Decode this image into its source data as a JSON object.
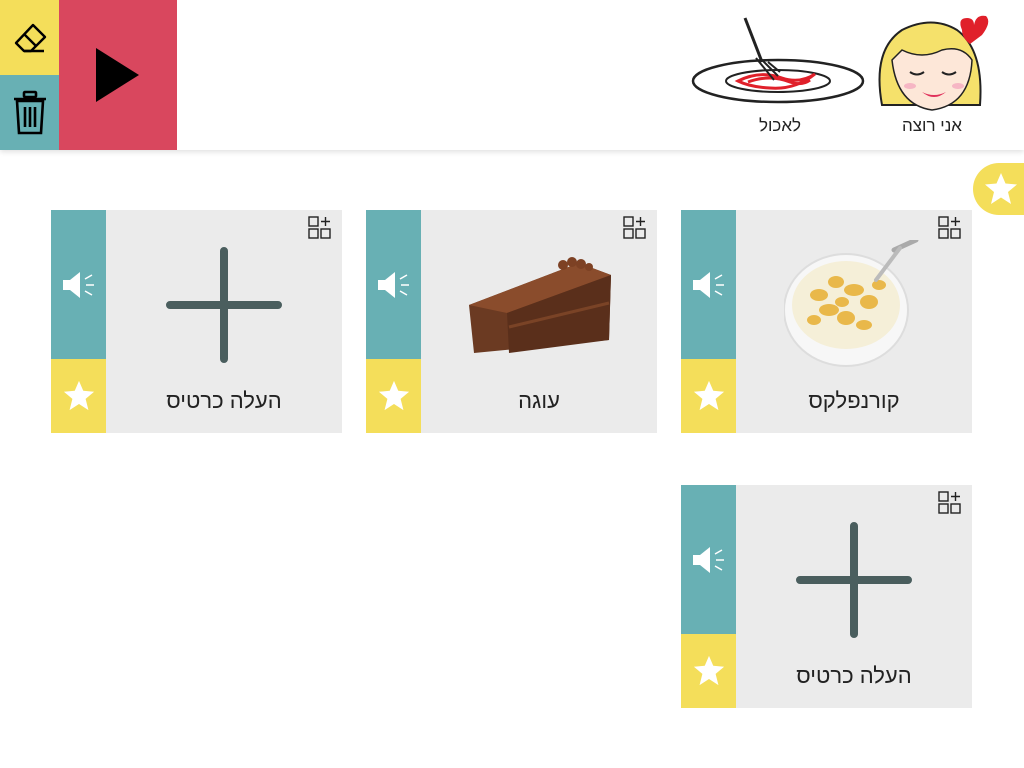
{
  "toolbar": {
    "erase_icon": "eraser-icon",
    "trash_icon": "trash-icon",
    "play_icon": "play-icon"
  },
  "sentence": [
    {
      "label": "אני רוצה",
      "icon": "girl-face-icon"
    },
    {
      "label": "לאכול",
      "icon": "plate-fork-icon"
    }
  ],
  "favorites_icon": "star-icon",
  "cards": [
    {
      "label": "קורנפלקס",
      "image": "cornflakes-bowl-image"
    },
    {
      "label": "עוגה",
      "image": "chocolate-cake-image"
    },
    {
      "label": "העלה כרטיס",
      "image": "plus-icon"
    },
    {
      "label": "העלה כרטיס",
      "image": "plus-icon"
    }
  ],
  "colors": {
    "yellow": "#f4de5a",
    "teal": "#68b0b4",
    "red": "#d9475e",
    "card_bg": "#ebebeb"
  }
}
